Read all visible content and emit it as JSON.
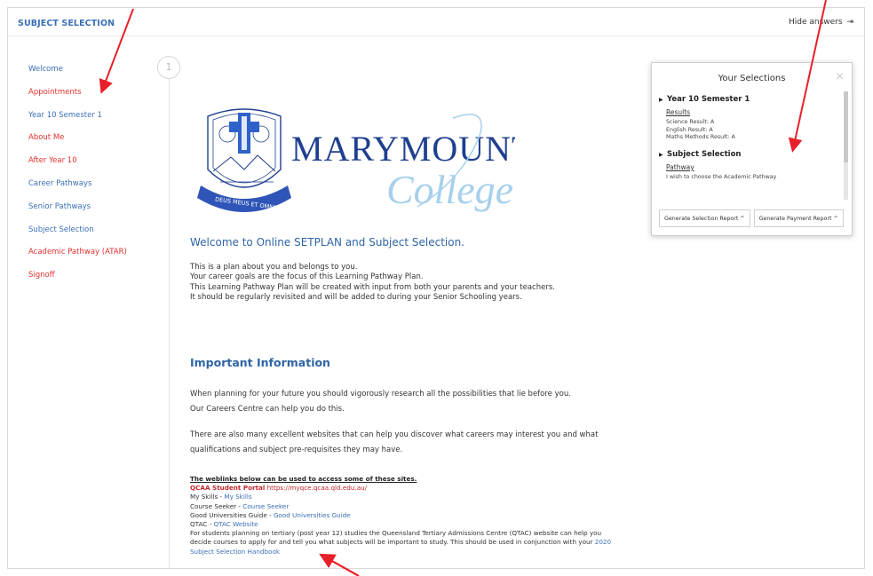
{
  "header": {
    "title": "SUBJECT SELECTION",
    "hide_answers": "Hide answers",
    "hide_icon": "exit-icon"
  },
  "sidebar": {
    "items": [
      {
        "label": "Welcome",
        "color": "#3b6fb6"
      },
      {
        "label": "Appointments",
        "color": "#e0322e"
      },
      {
        "label": "Year 10 Semester 1",
        "color": "#3b6fb6"
      },
      {
        "label": "About Me",
        "color": "#e0322e"
      },
      {
        "label": "After Year 10",
        "color": "#e0322e"
      },
      {
        "label": "Career Pathways",
        "color": "#3b6fb6"
      },
      {
        "label": "Senior Pathways",
        "color": "#3b6fb6"
      },
      {
        "label": "Subject Selection",
        "color": "#3b6fb6"
      },
      {
        "label": "Academic Pathway (ATAR)",
        "color": "#e0322e"
      },
      {
        "label": "Signoff",
        "color": "#e0322e"
      }
    ]
  },
  "timeline": {
    "step": "1"
  },
  "logo": {
    "name": "MARYMOUNT",
    "script": "College",
    "motto": "DEUS MEUS ET OMNIA"
  },
  "main": {
    "welcome_heading": "Welcome to Online SETPLAN and Subject Selection.",
    "intro_lines": [
      "This is a plan about you and belongs to you.",
      "Your career goals are the focus of this Learning Pathway Plan.",
      "This Learning Pathway Plan will be created with input from both your parents and your teachers.",
      "It should be regularly revisited and will be added to during your Senior Schooling years."
    ],
    "important_heading": "Important Information",
    "para1": [
      "When planning for your future you should vigorously research all the possibilities that lie before you.",
      "Our Careers Centre can help you do this."
    ],
    "para2": [
      "There are also many excellent websites that can help you discover what careers may interest you and what",
      "qualifications and subject pre-requisites they may have."
    ],
    "links": {
      "intro": "The weblinks below can be used to access some of these sites.",
      "qcaa_label": "QCAA Student Portal",
      "qcaa_url": "https://myqce.qcaa.qld.edu.au/",
      "myskills_prefix": "My Skills - ",
      "myskills_link": "My Skills",
      "courseseeker_prefix": "Course Seeker - ",
      "courseseeker_link": "Course Seeker",
      "gug_prefix": "Good Universities Guide - ",
      "gug_link": "Good Universities Guide",
      "qtac_prefix": "QTAC - ",
      "qtac_link": "QTAC Website",
      "tertiary_line1": "For students planning on tertiary (post year 12) studies the Queensland Tertiary Admissions Centre (QTAC) website can help you",
      "tertiary_line2_prefix": "decide courses to apply for and tell you what subjects will be important to study. This should be used in conjunction with your ",
      "tertiary_link_part1": "2020",
      "tertiary_link_part2": "Subject Selection Handbook"
    }
  },
  "selections_panel": {
    "title": "Your Selections",
    "close": "×",
    "sections": [
      {
        "heading": "Year 10 Semester 1",
        "sub": "Results",
        "items": [
          "Science Result: A",
          "English Result: A",
          "Maths Methods Result: A"
        ]
      },
      {
        "heading": "Subject Selection",
        "sub": "Pathway",
        "items": [
          "I wish to choose the Academic Pathway"
        ]
      }
    ],
    "buttons": [
      "Generate Selection Report ^",
      "Generate Payment Report ^"
    ]
  },
  "colors": {
    "accent_blue": "#3b6fb6",
    "alert_red": "#e0322e",
    "arrow_red": "#e8202a"
  }
}
